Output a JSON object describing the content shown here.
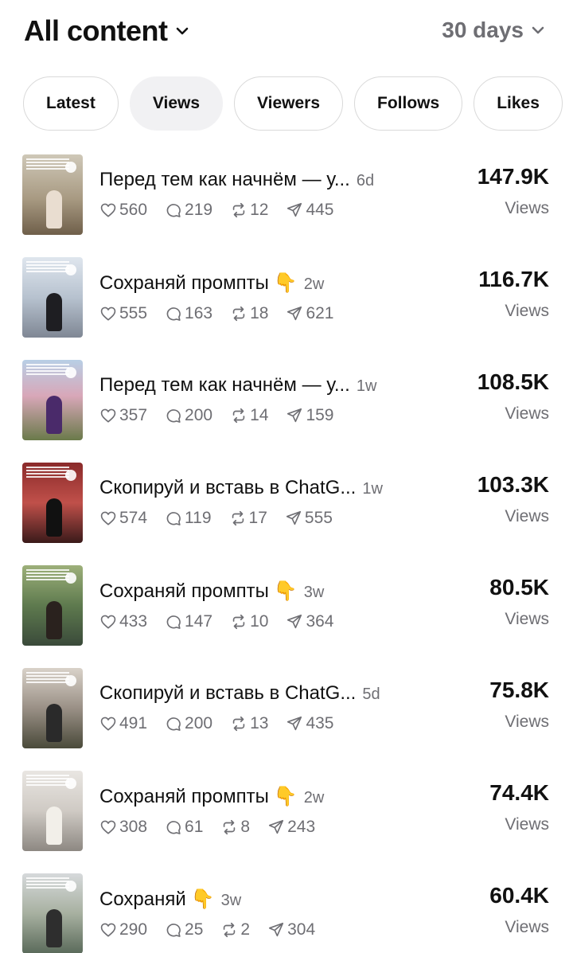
{
  "header": {
    "title": "All content",
    "range": "30 days"
  },
  "tabs": [
    {
      "label": "Latest",
      "active": false
    },
    {
      "label": "Views",
      "active": true
    },
    {
      "label": "Viewers",
      "active": false
    },
    {
      "label": "Follows",
      "active": false
    },
    {
      "label": "Likes",
      "active": false
    }
  ],
  "posts": [
    {
      "title": "Перед тем как начнём — у...",
      "emoji": "",
      "age": "6d",
      "likes": "560",
      "comments": "219",
      "reposts": "12",
      "shares": "445",
      "metric": "147.9K",
      "metric_label": "Views"
    },
    {
      "title": "Сохраняй промпты",
      "emoji": "👇",
      "age": "2w",
      "likes": "555",
      "comments": "163",
      "reposts": "18",
      "shares": "621",
      "metric": "116.7K",
      "metric_label": "Views"
    },
    {
      "title": "Перед тем как начнём — у...",
      "emoji": "",
      "age": "1w",
      "likes": "357",
      "comments": "200",
      "reposts": "14",
      "shares": "159",
      "metric": "108.5K",
      "metric_label": "Views"
    },
    {
      "title": "Скопируй и вставь в ChatG...",
      "emoji": "",
      "age": "1w",
      "likes": "574",
      "comments": "119",
      "reposts": "17",
      "shares": "555",
      "metric": "103.3K",
      "metric_label": "Views"
    },
    {
      "title": "Сохраняй промпты",
      "emoji": "👇",
      "age": "3w",
      "likes": "433",
      "comments": "147",
      "reposts": "10",
      "shares": "364",
      "metric": "80.5K",
      "metric_label": "Views"
    },
    {
      "title": "Скопируй и вставь в ChatG...",
      "emoji": "",
      "age": "5d",
      "likes": "491",
      "comments": "200",
      "reposts": "13",
      "shares": "435",
      "metric": "75.8K",
      "metric_label": "Views"
    },
    {
      "title": "Сохраняй промпты",
      "emoji": "👇",
      "age": "2w",
      "likes": "308",
      "comments": "61",
      "reposts": "8",
      "shares": "243",
      "metric": "74.4K",
      "metric_label": "Views"
    },
    {
      "title": "Сохраняй",
      "emoji": "👇",
      "age": "3w",
      "likes": "290",
      "comments": "25",
      "reposts": "2",
      "shares": "304",
      "metric": "60.4K",
      "metric_label": "Views"
    }
  ],
  "icons": {
    "title_dropdown": "chevron-down-icon",
    "range_dropdown": "chevron-down-icon",
    "likes": "heart-icon",
    "comments": "comment-icon",
    "reposts": "repost-icon",
    "shares": "share-icon",
    "thumb_play": "play-icon"
  },
  "colors": {
    "text": "#111111",
    "secondary": "#6e6e73",
    "tab_border": "#d9d9d9",
    "tab_active_bg": "#f1f1f3"
  }
}
